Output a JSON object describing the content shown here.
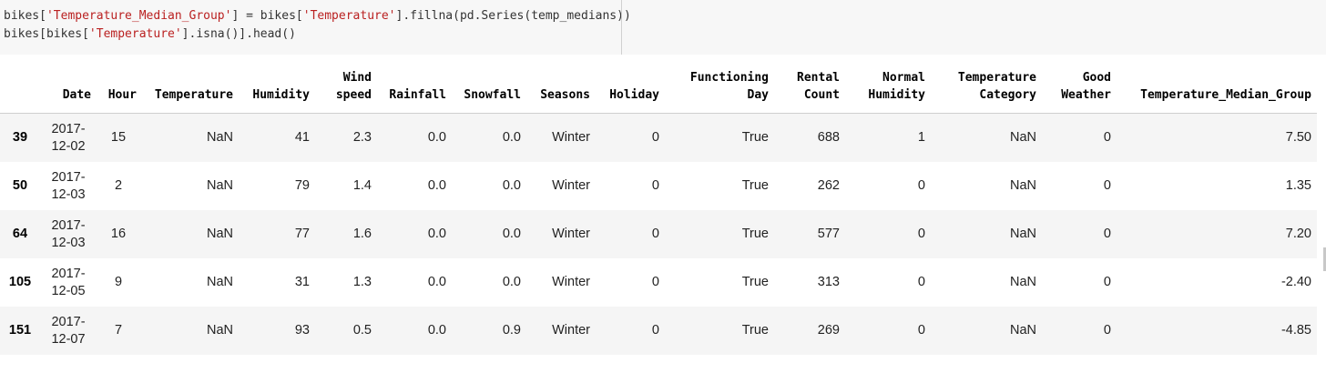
{
  "code": {
    "line1": {
      "a": "bikes[",
      "b": "'Temperature_Median_Group'",
      "c": "] = bikes[",
      "d": "'Temperature'",
      "e": "].fillna(pd.Series(temp_medians))"
    },
    "line2": {
      "a": "bikes[bikes[",
      "b": "'Temperature'",
      "c": "].isna()].head()"
    }
  },
  "table": {
    "columns": [
      "",
      "Date",
      "Hour",
      "Temperature",
      "Humidity",
      "Wind speed",
      "Rainfall",
      "Snowfall",
      "Seasons",
      "Holiday",
      "Functioning Day",
      "Rental Count",
      "Normal Humidity",
      "Temperature Category",
      "Good Weather",
      "Temperature_Median_Group"
    ],
    "rows": [
      {
        "index": "39",
        "cells": [
          "2017-12-02",
          "15",
          "NaN",
          "41",
          "2.3",
          "0.0",
          "0.0",
          "Winter",
          "0",
          "True",
          "688",
          "1",
          "NaN",
          "0",
          "7.50"
        ]
      },
      {
        "index": "50",
        "cells": [
          "2017-12-03",
          "2",
          "NaN",
          "79",
          "1.4",
          "0.0",
          "0.0",
          "Winter",
          "0",
          "True",
          "262",
          "0",
          "NaN",
          "0",
          "1.35"
        ]
      },
      {
        "index": "64",
        "cells": [
          "2017-12-03",
          "16",
          "NaN",
          "77",
          "1.6",
          "0.0",
          "0.0",
          "Winter",
          "0",
          "True",
          "577",
          "0",
          "NaN",
          "0",
          "7.20"
        ]
      },
      {
        "index": "105",
        "cells": [
          "2017-12-05",
          "9",
          "NaN",
          "31",
          "1.3",
          "0.0",
          "0.0",
          "Winter",
          "0",
          "True",
          "313",
          "0",
          "NaN",
          "0",
          "-2.40"
        ]
      },
      {
        "index": "151",
        "cells": [
          "2017-12-07",
          "7",
          "NaN",
          "93",
          "0.5",
          "0.0",
          "0.9",
          "Winter",
          "0",
          "True",
          "269",
          "0",
          "NaN",
          "0",
          "-4.85"
        ]
      }
    ]
  }
}
